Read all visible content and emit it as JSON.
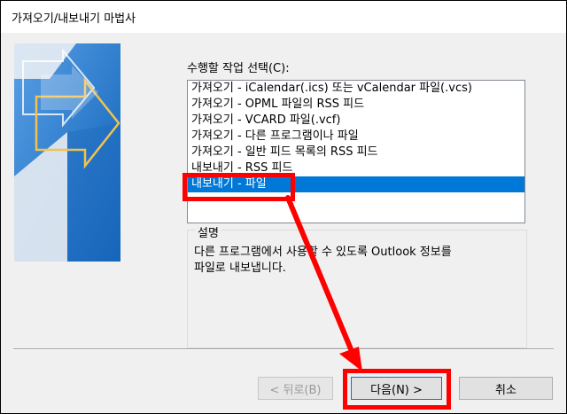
{
  "window": {
    "title": "가져오기/내보내기 마법사"
  },
  "task": {
    "label": "수행할 작업 선택(C):",
    "items": [
      {
        "label": "가져오기 - iCalendar(.ics) 또는 vCalendar 파일(.vcs)",
        "selected": false
      },
      {
        "label": "가져오기 - OPML 파일의 RSS 피드",
        "selected": false
      },
      {
        "label": "가져오기 - VCARD 파일(.vcf)",
        "selected": false
      },
      {
        "label": "가져오기 - 다른 프로그램이나 파일",
        "selected": false
      },
      {
        "label": "가져오기 - 일반 피드 목록의 RSS 피드",
        "selected": false
      },
      {
        "label": "내보내기 - RSS 피드",
        "selected": false
      },
      {
        "label": "내보내기 - 파일",
        "selected": true
      }
    ]
  },
  "description": {
    "title": "설명",
    "line1": "다른 프로그램에서 사용할 수 있도록 Outlook 정보를",
    "line2": "파일로 내보냅니다."
  },
  "buttons": {
    "back": "< 뒤로(B)",
    "next": "다음(N) >",
    "cancel": "취소"
  },
  "colors": {
    "selection": "#0078d7",
    "annotation": "#ff0000",
    "banner_blue": "#1a73c8"
  }
}
